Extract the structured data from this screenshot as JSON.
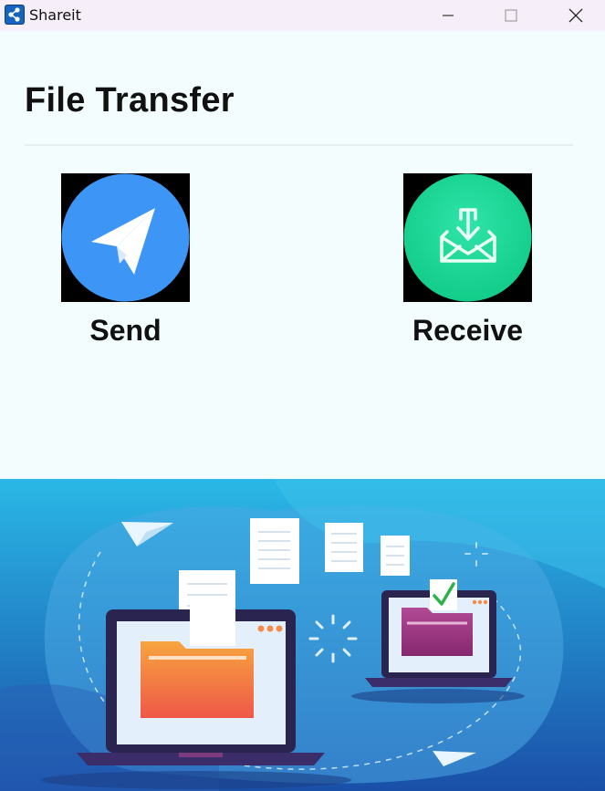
{
  "window": {
    "title": "Shareit",
    "app_icon": "share-icon",
    "controls": [
      "minimize-icon",
      "maximize-icon",
      "close-icon"
    ]
  },
  "main": {
    "title": "File Transfer",
    "actions": [
      {
        "label": "Send",
        "icon": "paper-plane-icon",
        "color": "#3d96f5"
      },
      {
        "label": "Receive",
        "icon": "download-envelope-icon",
        "color": "#1ed79a"
      }
    ]
  },
  "banner": {
    "illustration": "file-transfer-illustration",
    "colors": {
      "top": "#2ab8e6",
      "bottom": "#1a4fa8"
    }
  }
}
